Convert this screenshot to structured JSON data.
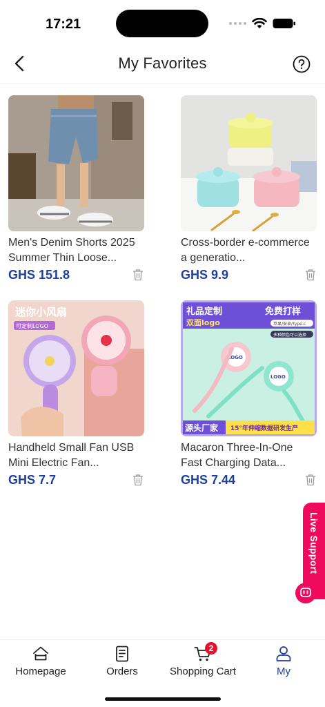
{
  "status_bar": {
    "time": "17:21"
  },
  "header": {
    "title": "My Favorites"
  },
  "products": [
    {
      "name": "Men's Denim Shorts 2025 Summer Thin Loose...",
      "price": "GHS 151.8"
    },
    {
      "name": "Cross-border e-commerce a generatio...",
      "price": "GHS 9.9"
    },
    {
      "name": "Handheld Small Fan USB Mini Electric Fan...",
      "price": "GHS 7.7",
      "image_text": {
        "top": "迷你小风扇",
        "sub": "可定制LOGO"
      }
    },
    {
      "name": "Macaron Three-In-One Fast Charging Data...",
      "price": "GHS 7.44",
      "image_text": {
        "top_left": "礼品定制",
        "top_left2": "双面logo",
        "top_right": "免费打样",
        "tag1": "苹果/安卓/Type-c",
        "tag2": "多种颜色可以选择",
        "logo": "LOGO",
        "bottom_left": "源头厂家",
        "bottom_right": "15°年伸缩数据研发生产"
      }
    }
  ],
  "live_support": {
    "label": "Live Support"
  },
  "tabbar": {
    "items": [
      {
        "label": "Homepage"
      },
      {
        "label": "Orders"
      },
      {
        "label": "Shopping Cart",
        "badge": "2"
      },
      {
        "label": "My"
      }
    ]
  },
  "colors": {
    "accent": "#1e3fa0",
    "live_support": "#ef0a5e",
    "badge": "#e8112d"
  }
}
